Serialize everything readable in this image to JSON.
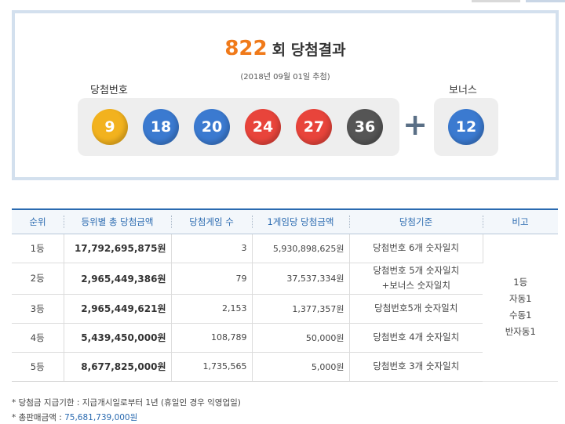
{
  "round": {
    "number": "822",
    "suffix": "회 당첨결과",
    "date": "(2018년 09월 01일 추첨)"
  },
  "labels": {
    "winning": "당첨번호",
    "bonus": "보너스",
    "plus": "+"
  },
  "winning_numbers": [
    {
      "value": "9",
      "color": "#f2b21e"
    },
    {
      "value": "18",
      "color": "#3b7ad0"
    },
    {
      "value": "20",
      "color": "#3b7ad0"
    },
    {
      "value": "24",
      "color": "#e8443b"
    },
    {
      "value": "27",
      "color": "#e8443b"
    },
    {
      "value": "36",
      "color": "#555555"
    }
  ],
  "bonus_number": {
    "value": "12",
    "color": "#3b7ad0"
  },
  "table": {
    "headers": [
      "순위",
      "등위별 총 당첨금액",
      "당첨게임 수",
      "1게임당 당첨금액",
      "당첨기준",
      "비고"
    ],
    "rows": [
      {
        "rank": "1등",
        "total": "17,792,695,875원",
        "games": "3",
        "prize": "5,930,898,625원",
        "criteria": "당첨번호 6개 숫자일치"
      },
      {
        "rank": "2등",
        "total": "2,965,449,386원",
        "games": "79",
        "prize": "37,537,334원",
        "criteria": "당첨번호 5개 숫자일치",
        "criteria2": "+보너스 숫자일치"
      },
      {
        "rank": "3등",
        "total": "2,965,449,621원",
        "games": "2,153",
        "prize": "1,377,357원",
        "criteria": "당첨번호5개 숫자일치"
      },
      {
        "rank": "4등",
        "total": "5,439,450,000원",
        "games": "108,789",
        "prize": "50,000원",
        "criteria": "당첨번호 4개 숫자일치"
      },
      {
        "rank": "5등",
        "total": "8,677,825,000원",
        "games": "1,735,565",
        "prize": "5,000원",
        "criteria": "당첨번호 3개 숫자일치"
      }
    ],
    "note_lines": [
      "1등",
      "자동1",
      "수동1",
      "반자동1"
    ]
  },
  "footnotes": {
    "deadline": "* 당첨금 지급기한 : 지급개시일로부터 1년 (휴일인 경우 익영업일)",
    "sales_label": "* 총판매금액 : ",
    "sales_amount": "75,681,739,000원"
  }
}
